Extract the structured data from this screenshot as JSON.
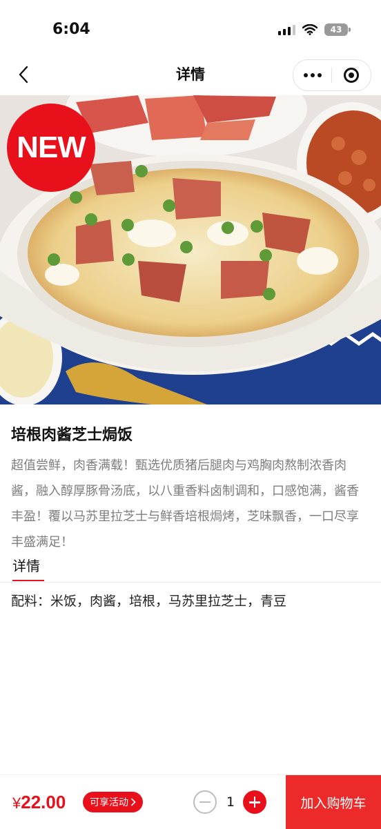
{
  "status_bar": {
    "time": "6:04",
    "battery": "43"
  },
  "nav": {
    "title": "详情",
    "back_icon": "chevron-left-icon",
    "more_icon": "more-dots-icon",
    "close_icon": "target-icon"
  },
  "hero": {
    "badge": "NEW",
    "accent_color": "#e8101a"
  },
  "product": {
    "name": "培根肉酱芝士焗饭",
    "description": "超值尝鲜，肉香满载！甄选优质猪后腿肉与鸡胸肉熬制浓香肉酱，融入醇厚豚骨汤底，以八重香料卤制调和，口感饱满，酱香丰盈！覆以马苏里拉芝士与鲜香培根焗烤，芝味飘香，一口尽享丰盛满足！"
  },
  "tab": {
    "label": "详情"
  },
  "ingredients": "配料：米饭，肉酱，培根，马苏里拉芝士，青豆",
  "bottom_bar": {
    "currency": "¥",
    "price": "22.00",
    "promo_label": "可享活动",
    "quantity": "1",
    "add_to_cart": "加入购物车"
  }
}
